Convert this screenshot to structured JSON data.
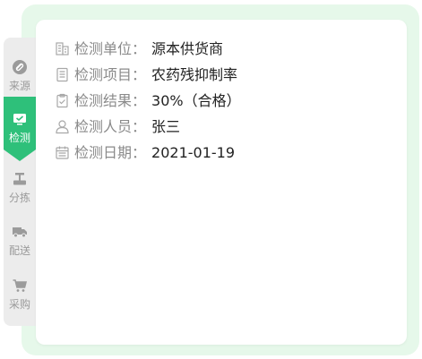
{
  "tabs": [
    {
      "label": "来源",
      "icon": "link-icon",
      "active": false
    },
    {
      "label": "检测",
      "icon": "monitor-check-icon",
      "active": true
    },
    {
      "label": "分拣",
      "icon": "scale-icon",
      "active": false
    },
    {
      "label": "配送",
      "icon": "truck-icon",
      "active": false
    },
    {
      "label": "采购",
      "icon": "cart-icon",
      "active": false
    }
  ],
  "details": [
    {
      "icon": "building-icon",
      "label": "检测单位",
      "value": "源本供货商"
    },
    {
      "icon": "list-doc-icon",
      "label": "检测项目",
      "value": "农药残抑制率"
    },
    {
      "icon": "clipboard-icon",
      "label": "检测结果",
      "value": "30%（合格）"
    },
    {
      "icon": "user-icon",
      "label": "检测人员",
      "value": "张三"
    },
    {
      "icon": "calendar-icon",
      "label": "检测日期",
      "value": "2021-01-19"
    }
  ],
  "colon": "：",
  "colors": {
    "accent": "#2ec07a",
    "outer_bg": "#e6f8ea",
    "tab_bg": "#ececec",
    "label": "#8a8a8a",
    "value": "#222222"
  }
}
